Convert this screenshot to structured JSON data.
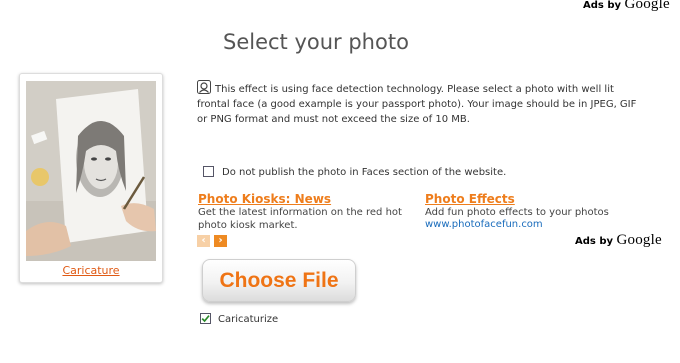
{
  "ads_top": {
    "prefix": "Ads by ",
    "brand": "Google"
  },
  "title": "Select your photo",
  "card": {
    "link_label": "Caricature"
  },
  "info": {
    "text": "This effect is using face detection technology. Please select a photo with well lit frontal face (a good example is your passport photo). Your image should be in JPEG, GIF or PNG format and must not exceed the size of 10 MB."
  },
  "publish": {
    "label": "Do not publish the photo in Faces section of the website.",
    "checked": false
  },
  "ads": [
    {
      "title": "Photo Kiosks: News",
      "desc": "Get the latest information on the red hot photo kiosk market.",
      "url": ""
    },
    {
      "title": "Photo Effects",
      "desc": "Add fun photo effects to your photos",
      "url": "www.photofacefun.com"
    }
  ],
  "ads_nav": {
    "prev": "‹",
    "next": "›"
  },
  "ads_mid": {
    "prefix": "Ads by ",
    "brand": "Google"
  },
  "choose_file": {
    "label": "Choose File"
  },
  "caricaturize": {
    "label": "Caricaturize",
    "checked": true
  },
  "colors": {
    "accent": "#ee7d1c",
    "link": "#e05a14",
    "url": "#1a6cbc"
  }
}
